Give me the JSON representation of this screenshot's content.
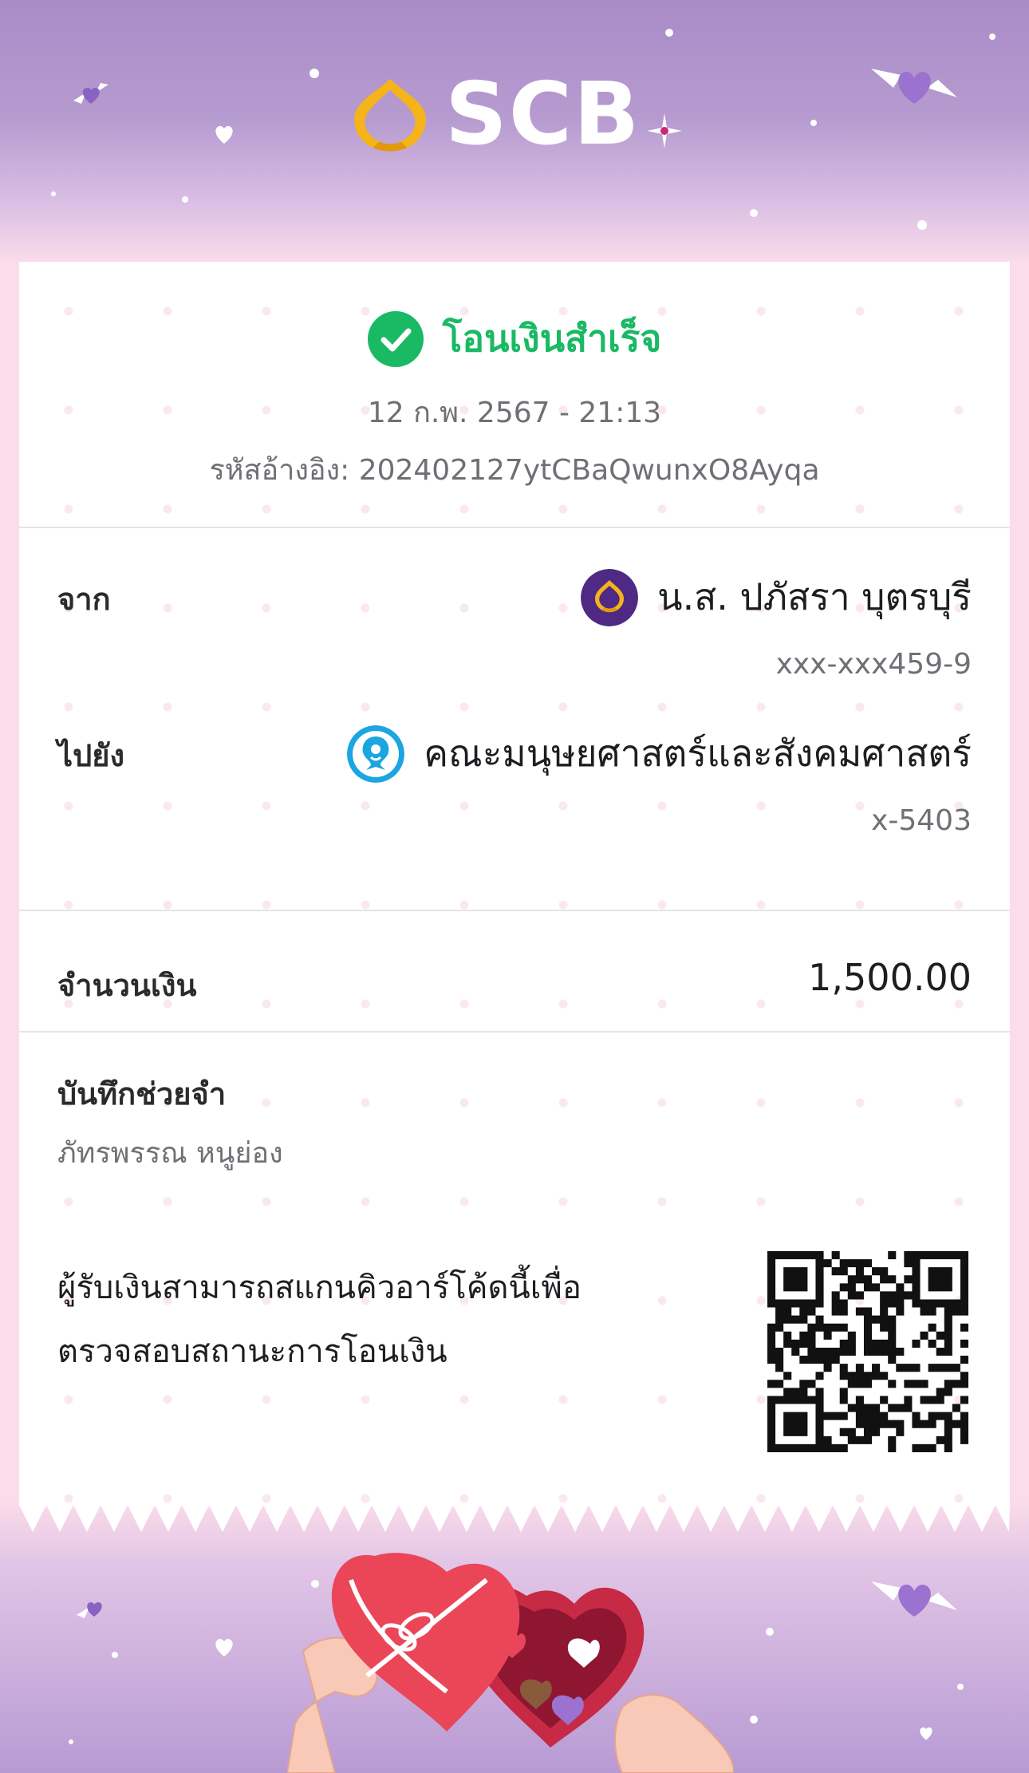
{
  "header": {
    "brand_name": "SCB"
  },
  "status": {
    "text": "โอนเงินสำเร็จ",
    "color": "#1ab964"
  },
  "transaction": {
    "datetime": "12 ก.พ. 2567 - 21:13",
    "reference": "รหัสอ้างอิง: 202402127ytCBaQwunxO8Ayqa"
  },
  "from": {
    "label": "จาก",
    "name": "น.ส. ปภัสรา บุตรบุรี",
    "account": "xxx-xxx459-9"
  },
  "to": {
    "label": "ไปยัง",
    "name": "คณะมนุษยศาสตร์และสังคมศาสตร์",
    "account": "x-5403"
  },
  "amount": {
    "label": "จำนวนเงิน",
    "value": "1,500.00"
  },
  "memo": {
    "label": "บันทึกช่วยจำ",
    "value": "ภัทรพรรณ หนูย่อง"
  },
  "qr_note": {
    "line1": "ผู้รับเงินสามารถสแกนคิวอาร์โค้ดนี้เพื่อ",
    "line2": "ตรวจสอบสถานะการโอนเงิน"
  },
  "colors": {
    "scb_purple": "#4e2a84",
    "scb_gold": "#f4b41a",
    "ktb_blue": "#1ba5e1"
  },
  "icons": [
    "scb-logo-icon",
    "success-check-icon",
    "scb-bank-icon",
    "krungthai-bank-icon",
    "qr-code-icon",
    "valentine-gift-illustration"
  ]
}
